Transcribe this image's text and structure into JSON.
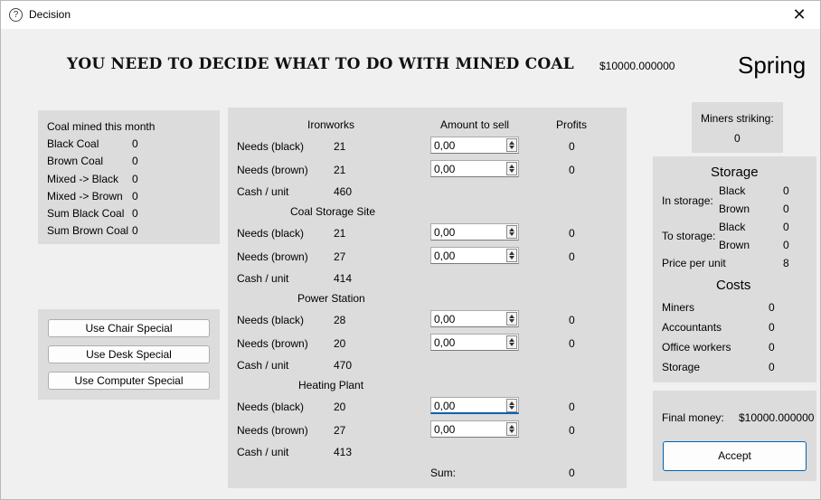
{
  "window": {
    "title": "Decision",
    "title_icon": "question-circle-icon",
    "close_glyph": "✕"
  },
  "header": {
    "headline": "YOU NEED TO DECIDE WHAT TO DO WITH MINED COAL",
    "money": "$10000.000000",
    "season": "Spring"
  },
  "mined": {
    "title": "Coal mined this month",
    "rows": [
      {
        "label": "Black Coal",
        "value": "0"
      },
      {
        "label": "Brown Coal",
        "value": "0"
      },
      {
        "label": "Mixed -> Black",
        "value": "0"
      },
      {
        "label": "Mixed -> Brown",
        "value": "0"
      },
      {
        "label": "Sum Black Coal",
        "value": "0"
      },
      {
        "label": "Sum Brown Coal",
        "value": "0"
      }
    ]
  },
  "specials": {
    "chair": "Use Chair Special",
    "desk": "Use Desk Special",
    "computer": "Use Computer Special"
  },
  "sales": {
    "col_amount": "Amount to sell",
    "col_profits": "Profits",
    "buyers": [
      {
        "name": "Ironworks",
        "needs_black_label": "Needs (black)",
        "needs_black": "21",
        "amount_black": "0,00",
        "profit_black": "0",
        "needs_brown_label": "Needs (brown)",
        "needs_brown": "21",
        "amount_brown": "0,00",
        "profit_brown": "0",
        "cash_label": "Cash / unit",
        "cash": "460"
      },
      {
        "name": "Coal Storage Site",
        "needs_black_label": "Needs (black)",
        "needs_black": "21",
        "amount_black": "0,00",
        "profit_black": "0",
        "needs_brown_label": "Needs (brown)",
        "needs_brown": "27",
        "amount_brown": "0,00",
        "profit_brown": "0",
        "cash_label": "Cash / unit",
        "cash": "414"
      },
      {
        "name": "Power Station",
        "needs_black_label": "Needs (black)",
        "needs_black": "28",
        "amount_black": "0,00",
        "profit_black": "0",
        "needs_brown_label": "Needs (brown)",
        "needs_brown": "20",
        "amount_brown": "0,00",
        "profit_brown": "0",
        "cash_label": "Cash / unit",
        "cash": "470"
      },
      {
        "name": "Heating Plant",
        "needs_black_label": "Needs (black)",
        "needs_black": "20",
        "amount_black": "0,00",
        "profit_black": "0",
        "needs_brown_label": "Needs (brown)",
        "needs_brown": "27",
        "amount_brown": "0,00",
        "profit_brown": "0",
        "cash_label": "Cash / unit",
        "cash": "413"
      }
    ],
    "sum_label": "Sum:",
    "sum_value": "0"
  },
  "strike": {
    "label": "Miners striking:",
    "value": "0"
  },
  "storage": {
    "title": "Storage",
    "in_storage_label": "In storage:",
    "to_storage_label": "To storage:",
    "black_label": "Black",
    "brown_label": "Brown",
    "in_black": "0",
    "in_brown": "0",
    "to_black": "0",
    "to_brown": "0",
    "price_label": "Price per unit",
    "price": "8"
  },
  "costs": {
    "title": "Costs",
    "rows": [
      {
        "label": "Miners",
        "value": "0"
      },
      {
        "label": "Accountants",
        "value": "0"
      },
      {
        "label": "Office workers",
        "value": "0"
      },
      {
        "label": "Storage",
        "value": "0"
      }
    ]
  },
  "final": {
    "label": "Final money:",
    "value": "$10000.000000",
    "accept": "Accept"
  }
}
